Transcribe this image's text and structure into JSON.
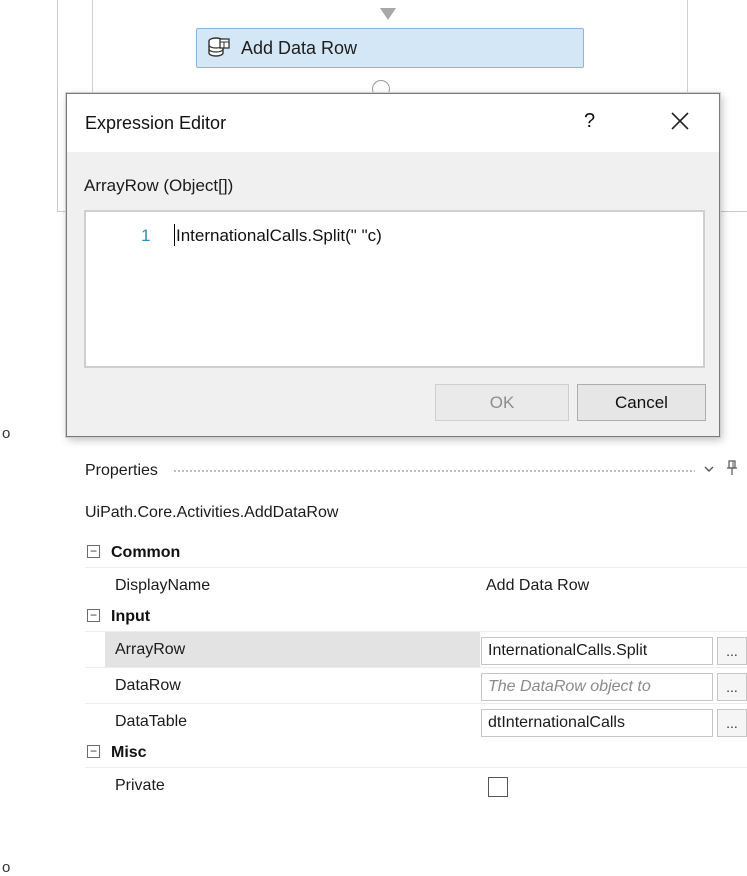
{
  "designer": {
    "activity_label": "Add Data Row",
    "activity_icon": "data-table-add-icon"
  },
  "expression_editor": {
    "title": "Expression Editor",
    "help_label": "?",
    "close_icon": "close-icon",
    "argument_label": "ArrayRow (Object[])",
    "line_number": "1",
    "code": "InternationalCalls.Split(\" \"c)",
    "ok_label": "OK",
    "cancel_label": "Cancel",
    "ok_enabled": false
  },
  "bullets": [
    "o",
    "o"
  ],
  "properties": {
    "title": "Properties",
    "dropdown_icon": "chevron-down-icon",
    "pin_icon": "pin-icon",
    "class_name": "UiPath.Core.Activities.AddDataRow",
    "collapse_glyph": "⊟",
    "ellipsis_label": "...",
    "categories": {
      "common": "Common",
      "input": "Input",
      "misc": "Misc"
    },
    "rows": {
      "display_name": {
        "name": "DisplayName",
        "value": "Add Data Row"
      },
      "array_row": {
        "name": "ArrayRow",
        "value": "InternationalCalls.Split"
      },
      "data_row": {
        "name": "DataRow",
        "placeholder": "The DataRow object to"
      },
      "data_table": {
        "name": "DataTable",
        "value": "dtInternationalCalls"
      },
      "private": {
        "name": "Private",
        "checked": false
      }
    }
  }
}
